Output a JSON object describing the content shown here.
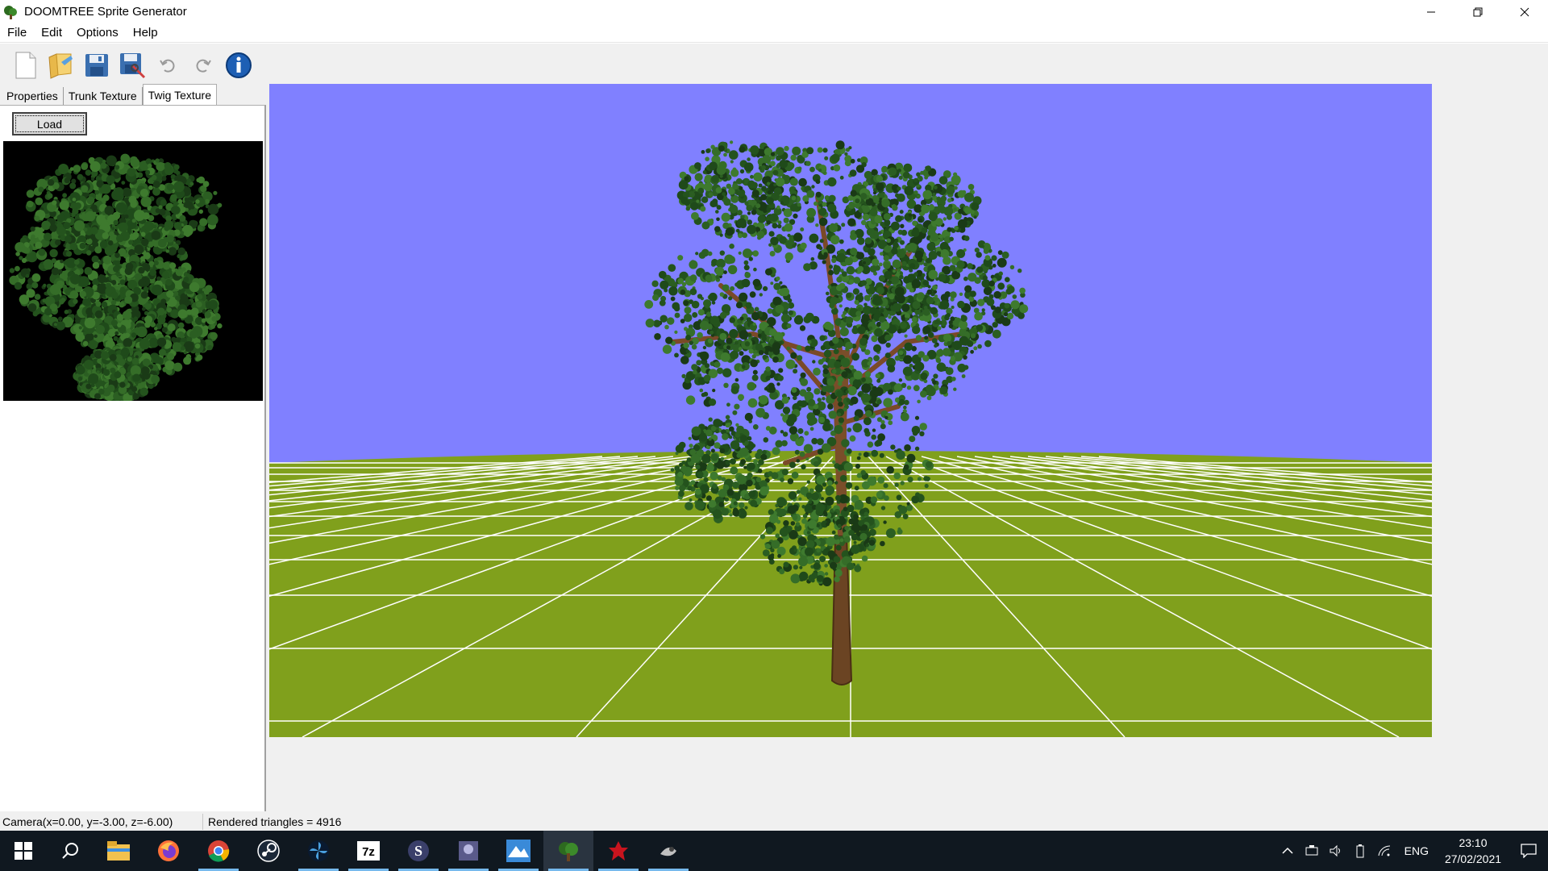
{
  "window": {
    "title": "DOOMTREE Sprite Generator",
    "icon": "tree-icon"
  },
  "menu": {
    "items": [
      "File",
      "Edit",
      "Options",
      "Help"
    ]
  },
  "toolbar": {
    "buttons": [
      {
        "name": "new-icon",
        "enabled": true
      },
      {
        "name": "open-folder-icon",
        "enabled": true
      },
      {
        "name": "save-icon",
        "enabled": true
      },
      {
        "name": "export-icon",
        "enabled": true
      },
      {
        "name": "undo-icon",
        "enabled": false
      },
      {
        "name": "redo-icon",
        "enabled": false
      },
      {
        "name": "info-icon",
        "enabled": true
      }
    ]
  },
  "tabs": [
    "Properties",
    "Trunk Texture",
    "Twig Texture"
  ],
  "active_tab": "Twig Texture",
  "twig_panel": {
    "load_label": "Load"
  },
  "viewport": {
    "sky_color": "#8080ff",
    "ground_color": "#80a01c",
    "grid_color": "#ffffff"
  },
  "status": {
    "camera": "Camera(x=0.00, y=-3.00, z=-6.00)",
    "triangles": "Rendered triangles = 4916"
  },
  "taskbar": {
    "apps": [
      {
        "name": "start-icon",
        "running": false,
        "active": false
      },
      {
        "name": "search-icon",
        "running": false,
        "active": false
      },
      {
        "name": "file-explorer-icon",
        "running": false,
        "active": false
      },
      {
        "name": "firefox-icon",
        "running": false,
        "active": false
      },
      {
        "name": "chrome-icon",
        "running": true,
        "active": false
      },
      {
        "name": "steam-icon",
        "running": false,
        "active": false
      },
      {
        "name": "fan-app-icon",
        "running": true,
        "active": false
      },
      {
        "name": "7zip-icon",
        "running": true,
        "active": false
      },
      {
        "name": "slade-icon",
        "running": true,
        "active": false
      },
      {
        "name": "uds-icon",
        "running": true,
        "active": false
      },
      {
        "name": "terragen-icon",
        "running": true,
        "active": false
      },
      {
        "name": "doomtree-icon",
        "running": true,
        "active": true
      },
      {
        "name": "red-app-icon",
        "running": true,
        "active": false
      },
      {
        "name": "paint-icon",
        "running": true,
        "active": false
      }
    ],
    "tray": {
      "language": "ENG",
      "time": "23:10",
      "date": "27/02/2021"
    }
  }
}
